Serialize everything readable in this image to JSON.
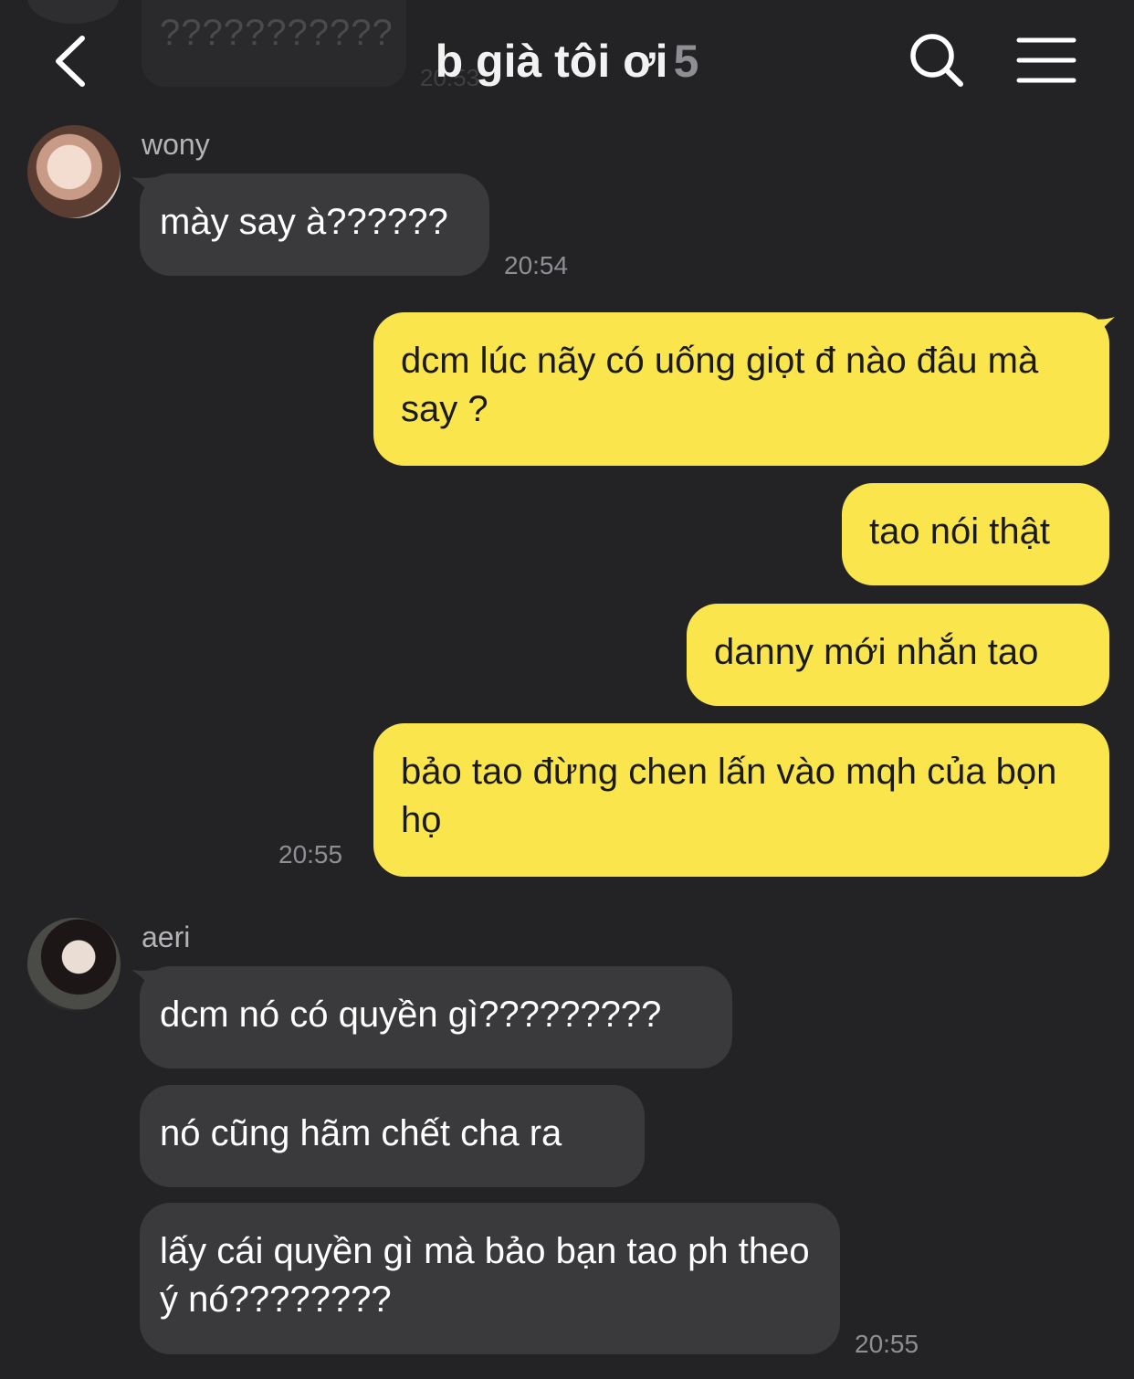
{
  "previous_message": {
    "text": "???????????",
    "time": "20:53"
  },
  "header": {
    "title": "b già tôi ơi",
    "member_count": "5"
  },
  "groups": [
    {
      "sender": "wony",
      "messages": [
        "mày say à??????"
      ],
      "time": "20:54"
    },
    {
      "sender": "me",
      "messages": [
        "dcm lúc nãy có uống giọt đ nào đâu mà say ?",
        "tao nói thật",
        "danny mới nhắn tao",
        "bảo tao đừng chen lấn vào mqh của bọn họ"
      ],
      "time": "20:55"
    },
    {
      "sender": "aeri",
      "messages": [
        "dcm nó có quyền gì?????????",
        "nó cũng hãm chết cha ra",
        "lấy cái quyền gì mà bảo bạn tao ph theo ý nó????????"
      ],
      "time": "20:55"
    }
  ],
  "colors": {
    "background": "#232325",
    "incoming_bubble": "#3a3a3c",
    "outgoing_bubble": "#fae54d"
  }
}
